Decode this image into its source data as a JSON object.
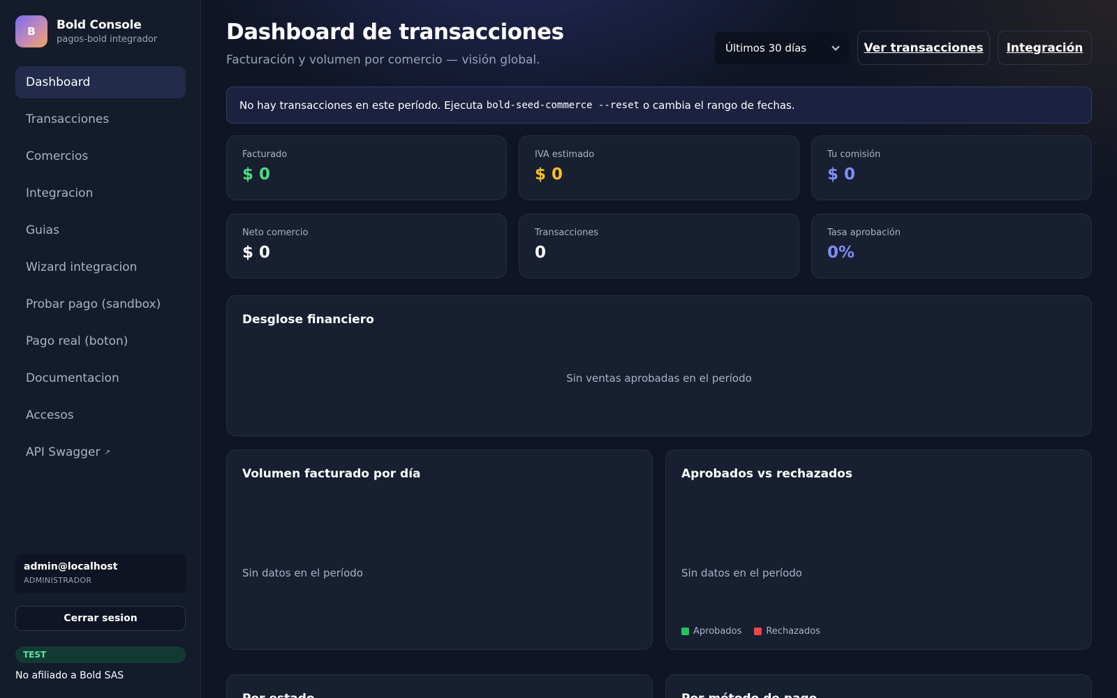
{
  "brand": {
    "logo_letter": "B",
    "title": "Bold Console",
    "subtitle": "pagos-bold integrador"
  },
  "nav": {
    "items": [
      {
        "label": "Dashboard",
        "active": true
      },
      {
        "label": "Transacciones"
      },
      {
        "label": "Comercios"
      },
      {
        "label": "Integracion"
      },
      {
        "label": "Guias"
      },
      {
        "label": "Wizard integracion"
      },
      {
        "label": "Probar pago (sandbox)"
      },
      {
        "label": "Pago real (boton)"
      },
      {
        "label": "Documentacion"
      },
      {
        "label": "Accesos"
      },
      {
        "label": "API Swagger",
        "icon": "external-link-icon",
        "icon_glyph": "↗"
      }
    ]
  },
  "user": {
    "email": "admin@localhost",
    "role": "ADMINISTRADOR"
  },
  "logout_label": "Cerrar sesion",
  "env_badge": "TEST",
  "disclaimer": "No afiliado a Bold SAS",
  "header": {
    "title": "Dashboard de transacciones",
    "subtitle": "Facturación y volumen por comercio — visión global.",
    "range_selected": "Últimos 30 días",
    "btn_transactions": "Ver transacciones",
    "btn_integration": "Integración"
  },
  "alert": {
    "before": "No hay transacciones en este período. Ejecuta",
    "command": "bold-seed-commerce --reset",
    "after": "o cambia el rango de fechas."
  },
  "kpis": [
    {
      "label": "Facturado",
      "value": "$ 0",
      "color": "#4ade80"
    },
    {
      "label": "IVA estimado",
      "value": "$ 0",
      "color": "#fbbf24"
    },
    {
      "label": "Tu comisión",
      "value": "$ 0",
      "color": "#818cf8"
    },
    {
      "label": "Neto comercio",
      "value": "$ 0",
      "color": "#ffffff"
    },
    {
      "label": "Transacciones",
      "value": "0",
      "color": "#ffffff"
    },
    {
      "label": "Tasa aprobación",
      "value": "0%",
      "color": "#818cf8"
    }
  ],
  "panels": {
    "breakdown": {
      "title": "Desglose financiero",
      "empty": "Sin ventas aprobadas en el período"
    },
    "daily_volume": {
      "title": "Volumen facturado por día",
      "empty": "Sin datos en el período"
    },
    "approved_vs_rejected": {
      "title": "Aprobados vs rechazados",
      "empty": "Sin datos en el período",
      "legend": [
        {
          "label": "Aprobados",
          "color": "#22c55e"
        },
        {
          "label": "Rechazados",
          "color": "#ef4444"
        }
      ]
    },
    "by_status": {
      "title": "Por estado"
    },
    "by_method": {
      "title": "Por método de pago"
    }
  }
}
